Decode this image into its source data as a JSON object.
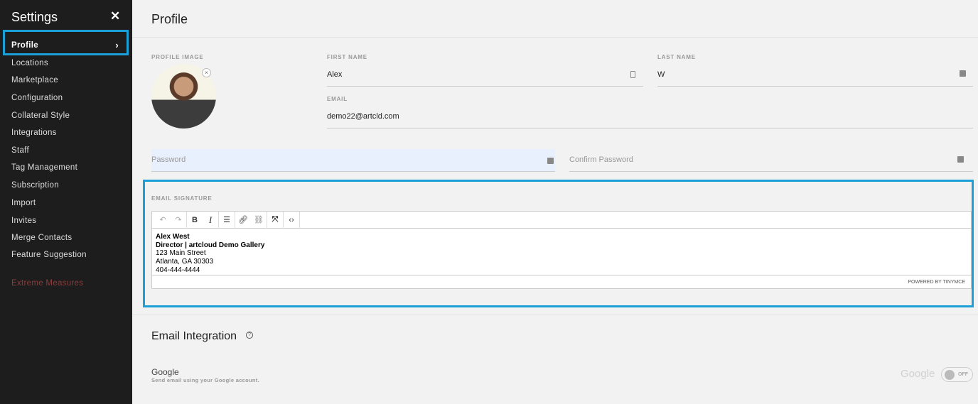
{
  "sidebar": {
    "title": "Settings",
    "close": "✕",
    "active": "Profile",
    "items": [
      "Locations",
      "Marketplace",
      "Configuration",
      "Collateral Style",
      "Integrations",
      "Staff",
      "Tag Management",
      "Subscription",
      "Import",
      "Invites",
      "Merge Contacts",
      "Feature Suggestion"
    ],
    "danger": "Extreme Measures"
  },
  "profile": {
    "title": "Profile",
    "image_label": "PROFILE IMAGE",
    "first_name_label": "FIRST NAME",
    "first_name": "Alex",
    "last_name_label": "LAST NAME",
    "last_name": "W",
    "email_label": "EMAIL",
    "email": "demo22@artcld.com",
    "password_placeholder": "Password",
    "confirm_placeholder": "Confirm Password"
  },
  "signature": {
    "label": "EMAIL SIGNATURE",
    "lines": [
      "Alex West",
      "Director | artcloud Demo Gallery",
      "123 Main Street",
      "Atlanta, GA 30303",
      "404-444-4444"
    ],
    "powered": "POWERED BY TINYMCE"
  },
  "integration": {
    "title": "Email Integration",
    "provider": "Google",
    "desc": "Send email using your Google account.",
    "logo": "Google",
    "toggle": "OFF"
  },
  "colors": {
    "accent": "#1a9fd6",
    "sidebar": "#1d1d1d",
    "danger": "#8e3b3b"
  }
}
